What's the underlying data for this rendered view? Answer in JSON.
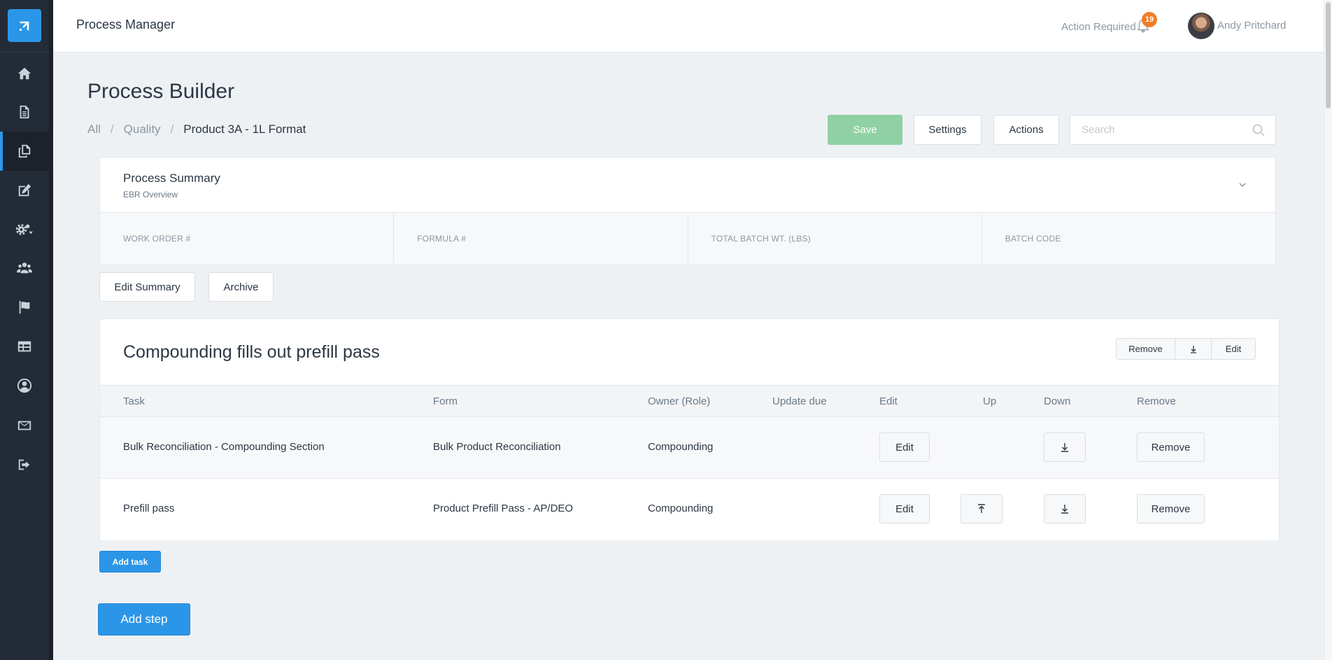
{
  "header": {
    "app_title": "Process Manager",
    "action_required": "Action Required",
    "notification_count": "19",
    "user_name": "Andy Pritchard"
  },
  "sidebar": {
    "items": [
      {
        "icon": "home-icon"
      },
      {
        "icon": "document-icon"
      },
      {
        "icon": "copy-icon",
        "active": true
      },
      {
        "icon": "edit-icon"
      },
      {
        "icon": "gears-icon"
      },
      {
        "icon": "users-icon"
      },
      {
        "icon": "flag-icon"
      },
      {
        "icon": "table-icon"
      },
      {
        "icon": "user-circle-icon"
      },
      {
        "icon": "envelope-icon"
      },
      {
        "icon": "sign-out-icon"
      }
    ]
  },
  "page": {
    "title": "Process Builder",
    "breadcrumb": [
      "All",
      "Quality",
      "Product 3A - 1L Format"
    ]
  },
  "toolbar": {
    "save_label": "Save",
    "settings_label": "Settings",
    "actions_label": "Actions",
    "search_placeholder": "Search"
  },
  "summary": {
    "title": "Process Summary",
    "subtitle": "EBR Overview",
    "fields": [
      "WORK ORDER #",
      "FORMULA #",
      "TOTAL BATCH WT. (LBS)",
      "BATCH CODE"
    ],
    "edit_label": "Edit Summary",
    "archive_label": "Archive"
  },
  "step": {
    "title": "Compounding fills out prefill pass",
    "remove_label": "Remove",
    "edit_label": "Edit",
    "columns": [
      "Task",
      "Form",
      "Owner (Role)",
      "Update due",
      "Edit",
      "Up",
      "Down",
      "Remove"
    ],
    "rows": [
      {
        "task": "Bulk Reconciliation - Compounding Section",
        "form": "Bulk Product Reconciliation",
        "owner": "Compounding",
        "update_due": "",
        "edit_label": "Edit",
        "remove_label": "Remove"
      },
      {
        "task": "Prefill pass",
        "form": "Product Prefill Pass - AP/DEO",
        "owner": "Compounding",
        "update_due": "",
        "edit_label": "Edit",
        "remove_label": "Remove"
      }
    ]
  },
  "add_task_label": "Add task",
  "add_step_label": "Add step",
  "colors": {
    "primary": "#2b96e8",
    "save": "#8fd1a3",
    "sidebar": "#232b36",
    "badge": "#f07e26"
  }
}
